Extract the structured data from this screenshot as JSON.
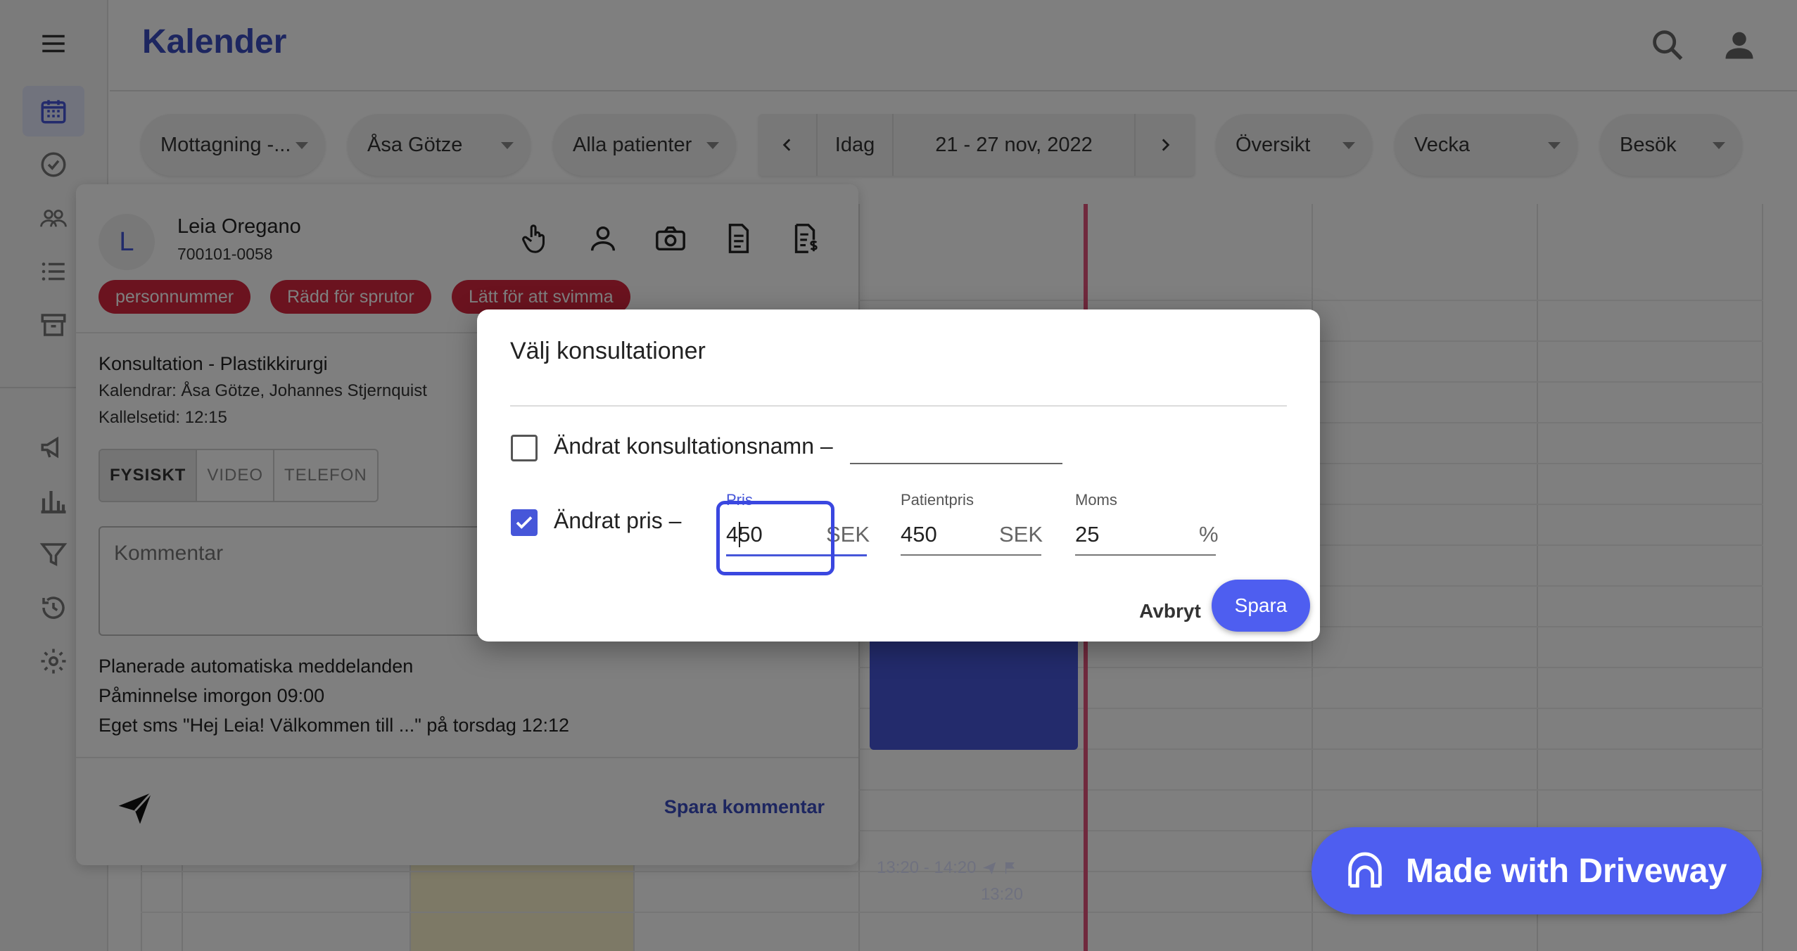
{
  "app": {
    "title": "Kalender",
    "colors": {
      "accent": "#3b4cc0",
      "primary_button": "#4e5ef0",
      "tag": "#d6263e",
      "now_line": "#e0537a",
      "event": "#4656d9"
    }
  },
  "sidebar": {
    "items": [
      {
        "icon": "menu-icon"
      },
      {
        "icon": "calendar-icon",
        "active": true
      },
      {
        "icon": "check-circle-icon"
      },
      {
        "icon": "people-icon"
      },
      {
        "icon": "list-icon"
      },
      {
        "icon": "archive-icon"
      },
      {
        "icon": "megaphone-icon"
      },
      {
        "icon": "bar-chart-icon"
      },
      {
        "icon": "filter-icon"
      },
      {
        "icon": "history-icon"
      },
      {
        "icon": "settings-icon"
      }
    ]
  },
  "topbar": {
    "icons": [
      "search-icon",
      "account-icon"
    ]
  },
  "filters": {
    "reception": "Mottagning -...",
    "staff": "Åsa Götze",
    "patients": "Alla patienter",
    "today": "Idag",
    "date_range": "21 - 27 nov, 2022",
    "overview": "Översikt",
    "period": "Vecka",
    "type": "Besök"
  },
  "event": {
    "line1": "13:20 - 14:20",
    "line2": "13:20"
  },
  "patient": {
    "initial": "L",
    "name": "Leia Oregano",
    "id": "700101-0058",
    "tags": [
      "personnummer",
      "Rädd för sprutor",
      "Lätt för att svimma"
    ],
    "consultation": "Konsultation - Plastikkirurgi",
    "calendars": "Kalendrar: Åsa Götze, Johannes Stjernquist",
    "call_time": "Kallelsetid: 12:15",
    "modes": [
      "FYSISKT",
      "VIDEO",
      "TELEFON"
    ],
    "comment_placeholder": "Kommentar",
    "auto_title": "Planerade automatiska meddelanden",
    "auto_items": [
      "Påminnelse imorgon 09:00",
      "Eget sms \"Hej Leia! Välkommen till ...\" på torsdag 12:12"
    ],
    "save_comment": "Spara kommentar"
  },
  "dialog": {
    "title": "Välj konsultationer",
    "changed_name_label": "Ändrat konsultationsnamn –",
    "changed_name_checked": false,
    "changed_price_label": "Ändrat pris –",
    "changed_price_checked": true,
    "price": {
      "label": "Pris",
      "value": "450",
      "suffix": "SEK"
    },
    "patient_price": {
      "label": "Patientpris",
      "value": "450",
      "suffix": "SEK"
    },
    "vat": {
      "label": "Moms",
      "value": "25",
      "suffix": "%"
    },
    "cancel": "Avbryt",
    "save": "Spara"
  },
  "badge": {
    "text": "Made with Driveway"
  }
}
